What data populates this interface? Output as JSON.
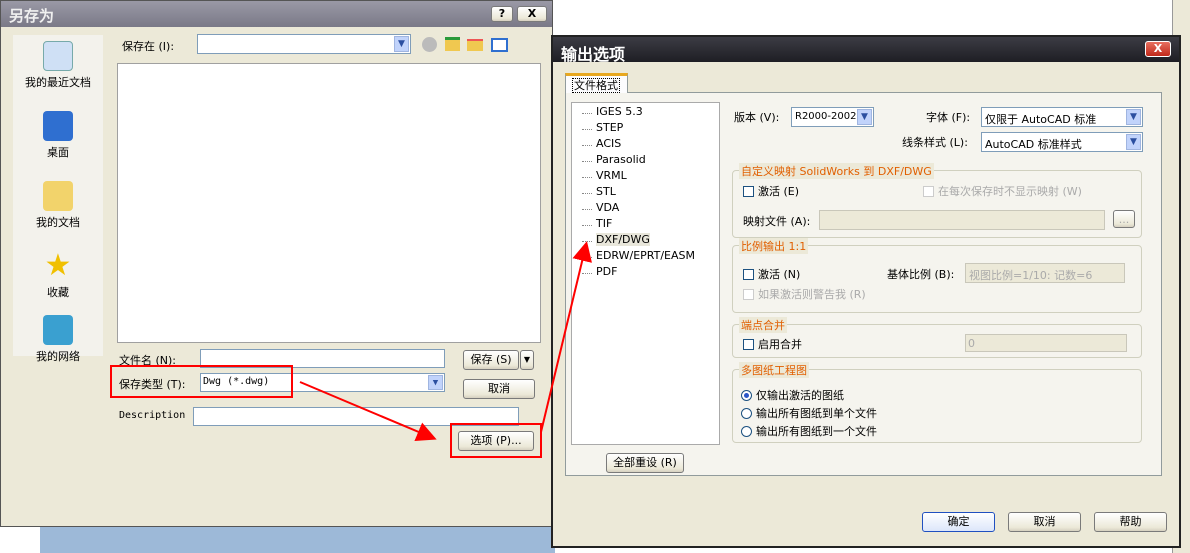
{
  "save_dialog": {
    "title": "另存为",
    "help_btn": "?",
    "close_btn": "X",
    "save_in_label": "保存在 (I):",
    "save_in_value": "",
    "places": [
      {
        "label": "我的最近文档",
        "icon": "recent-docs-icon"
      },
      {
        "label": "桌面",
        "icon": "desktop-icon"
      },
      {
        "label": "我的文档",
        "icon": "my-documents-icon"
      },
      {
        "label": "收藏",
        "icon": "favorites-icon"
      },
      {
        "label": "我的网络",
        "icon": "network-icon"
      }
    ],
    "filename_label": "文件名 (N):",
    "filename_value": "",
    "filetype_label": "保存类型 (T):",
    "filetype_value": "Dwg (*.dwg)",
    "description_label": "Description",
    "description_value": "",
    "save_btn": "保存 (S)",
    "cancel_btn": "取消",
    "options_btn": "选项 (P)..."
  },
  "options_dialog": {
    "title": "输出选项",
    "close_btn": "X",
    "tab": "文件格式",
    "formats": [
      "IGES 5.3",
      "STEP",
      "ACIS",
      "Parasolid",
      "VRML",
      "STL",
      "VDA",
      "TIF",
      "DXF/DWG",
      "EDRW/EPRT/EASM",
      "PDF"
    ],
    "selected_format": "DXF/DWG",
    "version_label": "版本 (V):",
    "version_value": "R2000-2002",
    "font_label": "字体 (F):",
    "font_value": "仅限于 AutoCAD 标准",
    "linestyle_label": "线条样式 (L):",
    "linestyle_value": "AutoCAD 标准样式",
    "mapping_group": "自定义映射 SolidWorks 到 DXF/DWG",
    "mapping_activate": "激活 (E)",
    "mapping_noshow": "在每次保存时不显示映射 (W)",
    "mapping_file_label": "映射文件 (A):",
    "mapping_file_value": "",
    "browse_btn": "...",
    "scale_group": "比例输出 1:1",
    "scale_activate": "激活 (N)",
    "base_scale_label": "基体比例 (B):",
    "base_scale_value": "视图比例=1/10: 记数=6",
    "scale_warn": "如果激活则警告我 (R)",
    "merge_group": "端点合并",
    "merge_enable": "启用合并",
    "merge_value": "0",
    "multi_group": "多图纸工程图",
    "multi_options": [
      "仅输出激活的图纸",
      "输出所有图纸到单个文件",
      "输出所有图纸到一个文件"
    ],
    "multi_selected": 0,
    "reset_btn": "全部重设 (R)",
    "ok_btn": "确定",
    "cancel_btn": "取消",
    "help_btn": "帮助"
  },
  "colors": {
    "annotation": "#ff0000",
    "group_label": "#e15f00"
  }
}
